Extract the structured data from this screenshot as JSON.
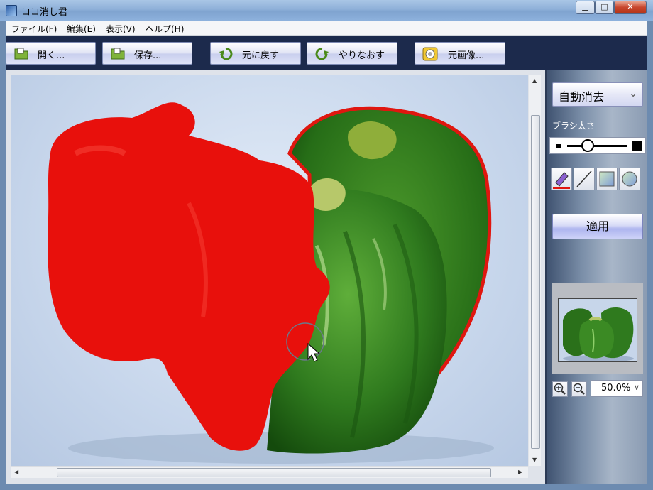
{
  "window": {
    "title": "ココ消し君",
    "minimize": "▁",
    "maximize": "□",
    "close": "✕"
  },
  "menu": [
    "ファイル(F)",
    "編集(E)",
    "表示(V)",
    "ヘルプ(H)"
  ],
  "toolbar": {
    "open_label": "開く...",
    "save_label": "保存...",
    "undo_label": "元に戻す",
    "redo_label": "やりなおす",
    "original_label": "元画像..."
  },
  "panel": {
    "mode_value": "自動消去",
    "brush_label": "ブラシ太さ",
    "brush_size_fraction": 0.35,
    "tools": [
      "pen-tool",
      "line-tool",
      "rect-tool",
      "circle-tool"
    ],
    "apply_label": "適用",
    "zoom_value": "50.0%"
  },
  "colors": {
    "mask_red": "#e8100c",
    "pepper_green": "#2f7a1e",
    "toolbar_bg": "#1c2a4c"
  }
}
